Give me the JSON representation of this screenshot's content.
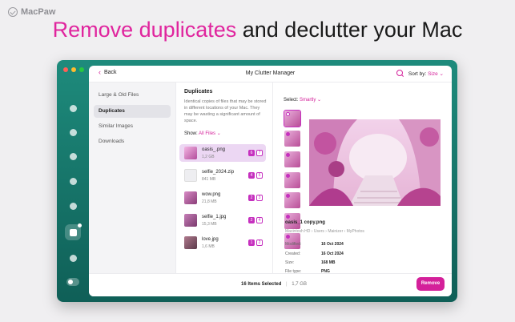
{
  "brand": {
    "name": "MacPaw",
    "icon": "macpaw-check-icon"
  },
  "headline": {
    "accent": "Remove duplicates",
    "rest": "and declutter your Mac"
  },
  "app": {
    "title": "My Clutter Manager",
    "back_label": "Back",
    "sort_label": "Sort by:",
    "sort_value": "Size",
    "accent_color": "#d4209a",
    "window_color": "#1a7a6e"
  },
  "rail": {
    "icons": [
      "files-icon",
      "storage-icon",
      "hand-icon",
      "bolt-icon",
      "app-store-icon",
      "folder-icon",
      "window-icon"
    ],
    "toggle": "toggle-icon"
  },
  "sidebar": {
    "items": [
      {
        "label": "Large & Old Files"
      },
      {
        "label": "Duplicates"
      },
      {
        "label": "Similar Images"
      },
      {
        "label": "Downloads"
      }
    ]
  },
  "duplicates": {
    "title": "Duplicates",
    "description": "Identical copies of files that may be stored in different locations of your Mac. They may be wasting a significant amount of space.",
    "show_label": "Show:",
    "show_value": "All Files",
    "files": [
      {
        "name": "oasis_.png",
        "size": "1,2 GB",
        "selected_count": "6",
        "total_count": "7"
      },
      {
        "name": "selfie_2024.zip",
        "size": "841 MB",
        "selected_count": "4",
        "total_count": "5"
      },
      {
        "name": "wow.png",
        "size": "21,8 MB",
        "selected_count": "2",
        "total_count": "3"
      },
      {
        "name": "selfie_1.jpg",
        "size": "15,3 MB",
        "selected_count": "2",
        "total_count": "4"
      },
      {
        "name": "love.jpg",
        "size": "1,6 MB",
        "selected_count": "1",
        "total_count": "2"
      }
    ]
  },
  "detail": {
    "select_label": "Select:",
    "select_value": "Smartly",
    "file_name": "oasis_1 copy.png",
    "path": "Macintosh HD › Users › Mainizer › MyPhotos",
    "modified_label": "Modified:",
    "modified_value": "16 Oct 2024",
    "created_label": "Created:",
    "created_value": "16 Oct 2024",
    "size_label": "Size:",
    "size_value": "168 MB",
    "type_label": "File type:",
    "type_value": "PNG"
  },
  "footer": {
    "items_selected": "16 Items Selected",
    "selected_size": "1,7 GB",
    "remove_label": "Remove"
  }
}
